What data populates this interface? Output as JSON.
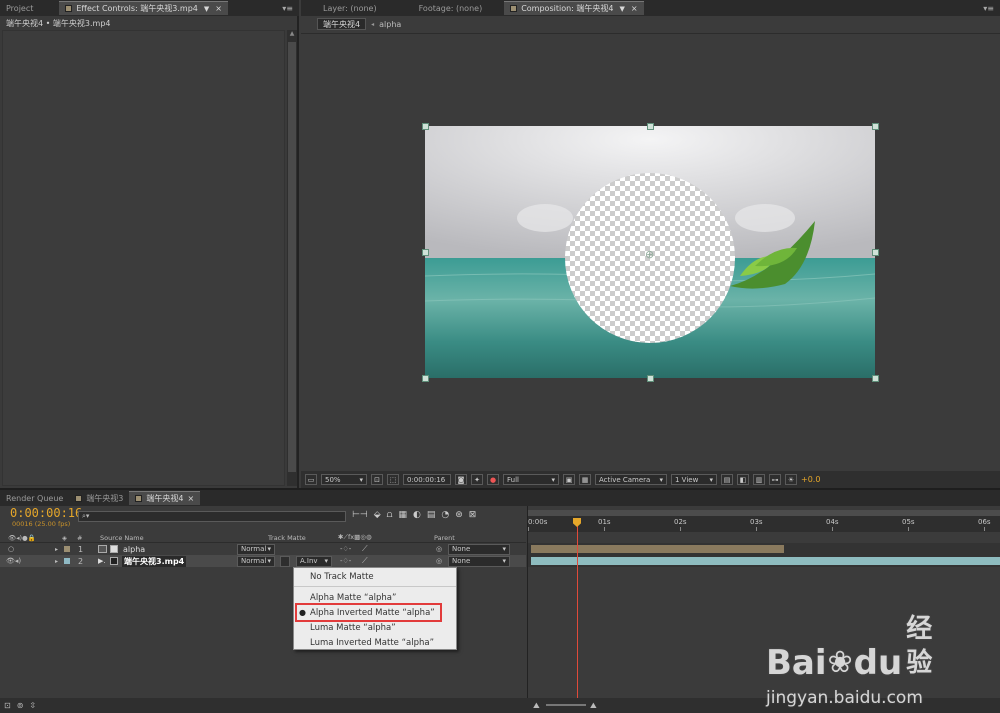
{
  "project_panel": {
    "tabs": [
      {
        "label": "Project",
        "active": false
      },
      {
        "label": "Effect Controls: 端午央视3.mp4",
        "active": true
      }
    ],
    "breadcrumb": "端午央视4 • 端午央视3.mp4"
  },
  "viewer_panel": {
    "tabs": [
      {
        "label": "Layer: (none)",
        "active": false
      },
      {
        "label": "Footage: (none)",
        "active": false
      },
      {
        "label": "Composition: 端午央视4",
        "active": true
      }
    ],
    "comp_breadcrumb": [
      "端午央视4",
      "alpha"
    ]
  },
  "viewer_footer": {
    "zoom": "50%",
    "timecode": "0:00:00:16",
    "resolution": "Full",
    "camera": "Active Camera",
    "view": "1 View",
    "exposure": "+0.0"
  },
  "timeline": {
    "tabs": [
      {
        "label": "Render Queue",
        "active": false
      },
      {
        "label": "端午央视3",
        "active": false
      },
      {
        "label": "端午央视4",
        "active": true
      }
    ],
    "current_time": "0:00:00:16",
    "frame_info": "00016 (25.00 fps)",
    "search_placeholder": "",
    "columns": {
      "num": "#",
      "source_name": "Source Name",
      "track_matte": "Track Matte",
      "parent": "Parent"
    },
    "layers": [
      {
        "num": "1",
        "name": "alpha",
        "mode": "Normal",
        "trkmat": "",
        "parent": "None",
        "label_color": "#9c8f72"
      },
      {
        "num": "2",
        "name": "端午央视3.mp4",
        "mode": "Normal",
        "trkmat": "A.Inv",
        "parent": "None",
        "label_color": "#8fb9c4"
      }
    ],
    "ruler_labels": [
      "0:00s",
      "01s",
      "02s",
      "03s",
      "04s",
      "05s",
      "06s"
    ],
    "playhead_fraction": 0.107
  },
  "track_matte_menu": {
    "items": [
      {
        "label": "No Track Matte",
        "selected": false
      },
      {
        "label": "Alpha Matte   “alpha”",
        "selected": false
      },
      {
        "label": "Alpha Inverted Matte   “alpha”",
        "selected": true
      },
      {
        "label": "Luma Matte   “alpha”",
        "selected": false
      },
      {
        "label": "Luma Inverted Matte   “alpha”",
        "selected": false
      }
    ]
  },
  "watermark": {
    "brand": "Bai",
    "brand2": "du",
    "suffix": "经验",
    "url": "jingyan.baidu.com"
  },
  "colors": {
    "timecode": "#e6a72a",
    "playhead": "#e04a3a",
    "highlight_box": "#e23b3b",
    "layer1_bar": "#8a7a5e",
    "layer2_bar": "#8ebcbf"
  }
}
